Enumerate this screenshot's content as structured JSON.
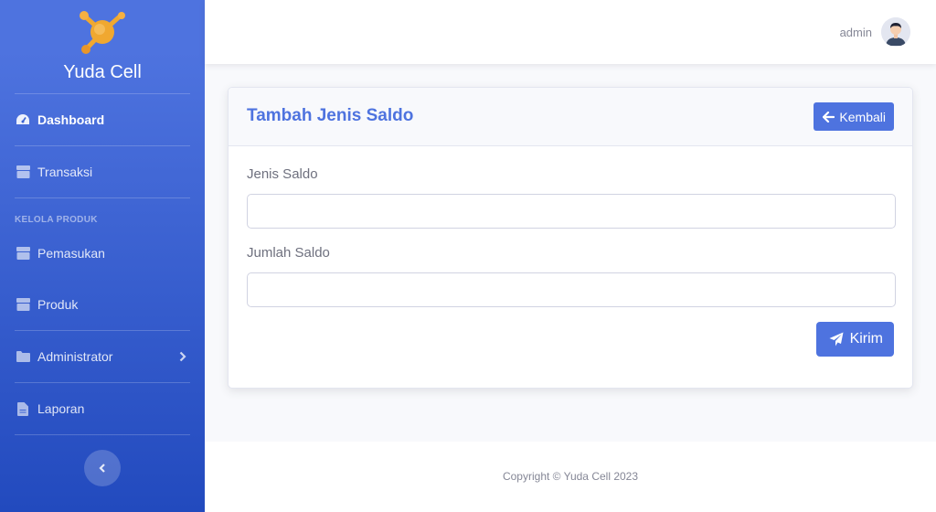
{
  "brand": {
    "name": "Yuda Cell"
  },
  "sidebar": {
    "items": [
      {
        "label": "Dashboard",
        "icon": "dashboard-icon"
      },
      {
        "label": "Transaksi",
        "icon": "box-icon"
      },
      {
        "label": "Pemasukan",
        "icon": "box-icon"
      },
      {
        "label": "Produk",
        "icon": "box-icon"
      },
      {
        "label": "Administrator",
        "icon": "folder-icon"
      },
      {
        "label": "Laporan",
        "icon": "file-icon"
      }
    ],
    "heading": "KELOLA PRODUK"
  },
  "topbar": {
    "user": "admin"
  },
  "card": {
    "title": "Tambah Jenis Saldo",
    "back_label": "Kembali",
    "fields": [
      {
        "label": "Jenis Saldo",
        "value": ""
      },
      {
        "label": "Jumlah Saldo",
        "value": ""
      }
    ],
    "submit_label": "Kirim"
  },
  "footer": {
    "copyright": "Copyright © Yuda Cell 2023"
  },
  "colors": {
    "primary": "#4e73df",
    "sidebar_dark": "#224abe",
    "logo": "#f0a830"
  }
}
